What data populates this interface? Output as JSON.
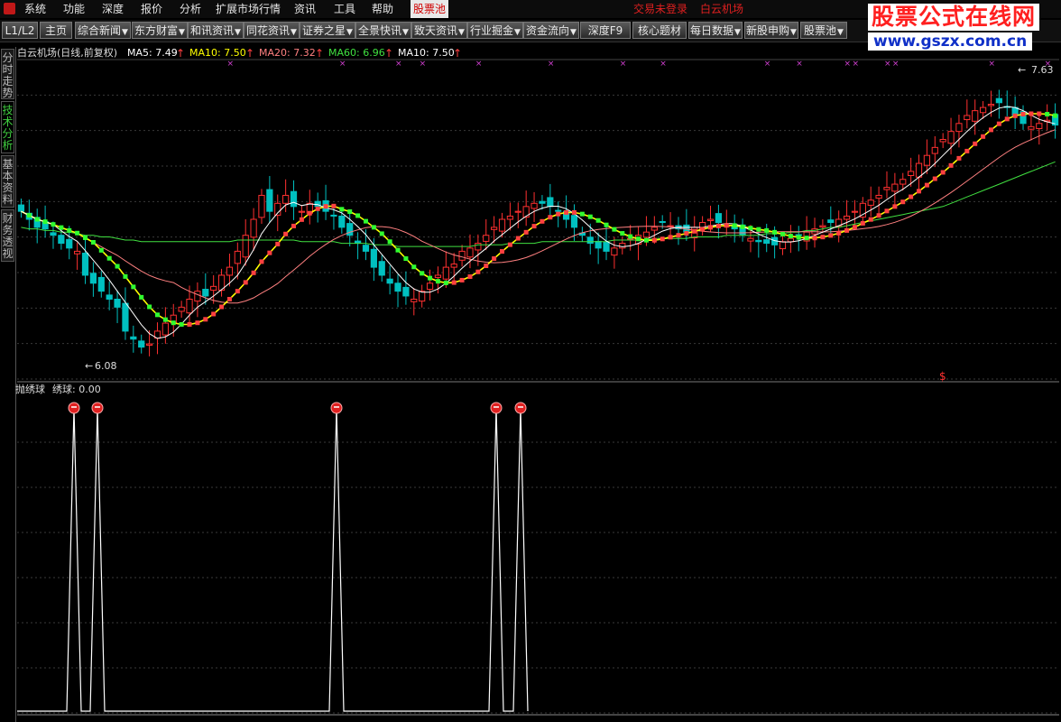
{
  "menu": {
    "items": [
      "系统",
      "功能",
      "深度",
      "报价",
      "分析",
      "扩展市场行情",
      "资讯",
      "工具",
      "帮助"
    ],
    "active": "股票池",
    "status_left": "交易未登录",
    "status_right": "白云机场"
  },
  "toolbar": {
    "level": "L1/L2",
    "home": "主页",
    "buttons": [
      "综合新闻",
      "东方财富",
      "和讯资讯",
      "同花资讯",
      "证券之星",
      "全景快讯",
      "致天资讯",
      "行业掘金",
      "资金流向"
    ],
    "depth": "深度F9",
    "core": "核心题材",
    "daily": "每日数据",
    "ipo": "新股申购",
    "pool": "股票池"
  },
  "watermark": {
    "title": "股票公式在线网",
    "url": "www.gszx.com.cn"
  },
  "side_tabs": [
    "分时走势",
    "技术分析",
    "基本资料",
    "财务透视"
  ],
  "main_chart": {
    "title": "白云机场(日线,前复权)",
    "indicators": [
      {
        "label": "MA5: 7.49",
        "color": "#ffffff"
      },
      {
        "label": "MA10: 7.50",
        "color": "#ffff00"
      },
      {
        "label": "MA20: 7.32",
        "color": "#ff8080"
      },
      {
        "label": "MA60: 6.96",
        "color": "#40e040"
      },
      {
        "label": "MA10: 7.50",
        "color": "#ffffff"
      }
    ],
    "low_label": "6.08",
    "high_label": "7.63",
    "dollar_mark": "$"
  },
  "sub_chart": {
    "name": "抛绣球",
    "value_label": "绣球: 0.00"
  },
  "colors": {
    "up": "#ff3030",
    "down": "#00c0c0",
    "ma5": "#ffffff",
    "ma10": "#ffff00",
    "ma20": "#ff8080",
    "ma60": "#40e040",
    "grid": "#3a3a3a",
    "green_marker": "#30ff30",
    "red_marker": "#ff4040",
    "cross": "#d040d0"
  },
  "chart_data": {
    "type": "line",
    "price_range": [
      5.9,
      7.9
    ],
    "grid_levels": 9,
    "close": [
      6.95,
      6.9,
      6.85,
      6.84,
      6.8,
      6.75,
      6.72,
      6.7,
      6.55,
      6.5,
      6.45,
      6.4,
      6.35,
      6.2,
      6.15,
      6.1,
      6.12,
      6.2,
      6.25,
      6.3,
      6.35,
      6.4,
      6.45,
      6.42,
      6.48,
      6.55,
      6.6,
      6.7,
      6.8,
      6.9,
      7.05,
      6.95,
      7.0,
      7.05,
      6.98,
      6.95,
      7.0,
      6.98,
      6.95,
      6.92,
      6.85,
      6.8,
      6.75,
      6.7,
      6.6,
      6.55,
      6.5,
      6.45,
      6.42,
      6.4,
      6.45,
      6.5,
      6.55,
      6.6,
      6.62,
      6.7,
      6.72,
      6.75,
      6.8,
      6.85,
      6.9,
      6.92,
      6.95,
      6.98,
      7.0,
      7.0,
      6.98,
      6.95,
      6.9,
      6.85,
      6.8,
      6.75,
      6.72,
      6.7,
      6.72,
      6.75,
      6.78,
      6.8,
      6.82,
      6.85,
      6.88,
      6.86,
      6.84,
      6.82,
      6.85,
      6.88,
      6.9,
      6.88,
      6.86,
      6.84,
      6.8,
      6.78,
      6.76,
      6.75,
      6.74,
      6.76,
      6.78,
      6.8,
      6.82,
      6.84,
      6.86,
      6.88,
      6.9,
      6.92,
      6.95,
      7.0,
      7.02,
      7.05,
      7.1,
      7.12,
      7.15,
      7.2,
      7.25,
      7.3,
      7.35,
      7.4,
      7.45,
      7.5,
      7.55,
      7.58,
      7.6,
      7.62,
      7.63,
      7.6,
      7.55,
      7.5,
      7.48,
      7.5,
      7.52,
      7.49
    ],
    "ma60": [
      6.85,
      6.84,
      6.84,
      6.83,
      6.83,
      6.82,
      6.82,
      6.81,
      6.8,
      6.8,
      6.79,
      6.79,
      6.78,
      6.77,
      6.77,
      6.76,
      6.76,
      6.76,
      6.76,
      6.76,
      6.76,
      6.76,
      6.76,
      6.76,
      6.76,
      6.76,
      6.76,
      6.77,
      6.77,
      6.77,
      6.77,
      6.77,
      6.77,
      6.77,
      6.77,
      6.76,
      6.76,
      6.76,
      6.76,
      6.76,
      6.75,
      6.75,
      6.75,
      6.75,
      6.74,
      6.74,
      6.74,
      6.73,
      6.73,
      6.73,
      6.73,
      6.73,
      6.73,
      6.73,
      6.73,
      6.73,
      6.73,
      6.74,
      6.74,
      6.74,
      6.74,
      6.75,
      6.75,
      6.75,
      6.75,
      6.76,
      6.76,
      6.76,
      6.76,
      6.76,
      6.76,
      6.76,
      6.76,
      6.76,
      6.77,
      6.77,
      6.77,
      6.77,
      6.77,
      6.78,
      6.78,
      6.78,
      6.78,
      6.78,
      6.79,
      6.79,
      6.79,
      6.79,
      6.8,
      6.8,
      6.8,
      6.8,
      6.8,
      6.81,
      6.81,
      6.81,
      6.82,
      6.82,
      6.83,
      6.83,
      6.84,
      6.85,
      6.85,
      6.86,
      6.87,
      6.88,
      6.89,
      6.9,
      6.91,
      6.92,
      6.93,
      6.94,
      6.95,
      6.96,
      6.97,
      6.98,
      7.0,
      7.02,
      7.04,
      7.06,
      7.08,
      7.1,
      7.12,
      7.14,
      7.16,
      7.18,
      7.2,
      7.22,
      7.24,
      7.26
    ],
    "signal_bars": [
      24,
      35,
      133,
      187,
      196
    ]
  }
}
